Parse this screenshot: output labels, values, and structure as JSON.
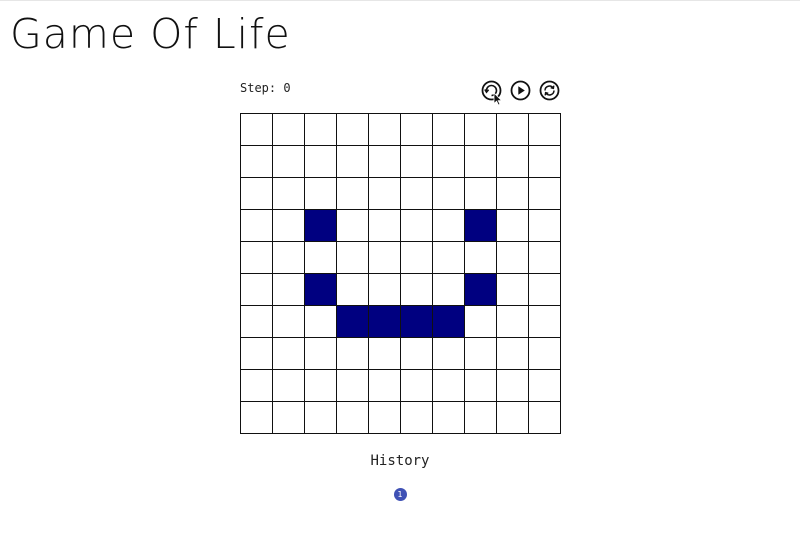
{
  "app": {
    "title": "Game Of Life"
  },
  "step": {
    "text": "Step: 0"
  },
  "controls": [
    {
      "name": "step-button",
      "icon": "step-rotate-icon"
    },
    {
      "name": "play-button",
      "icon": "play-icon"
    },
    {
      "name": "reset-button",
      "icon": "refresh-icon"
    }
  ],
  "board": {
    "rows": 10,
    "cols": 10,
    "alive_color": "#000080",
    "dead_color": "#ffffff",
    "alive_cells": [
      [
        3,
        2
      ],
      [
        3,
        7
      ],
      [
        5,
        2
      ],
      [
        5,
        7
      ],
      [
        6,
        3
      ],
      [
        6,
        4
      ],
      [
        6,
        5
      ],
      [
        6,
        6
      ]
    ]
  },
  "history": {
    "title": "History",
    "items": [
      "1"
    ],
    "item_color": "#3f51b5"
  }
}
